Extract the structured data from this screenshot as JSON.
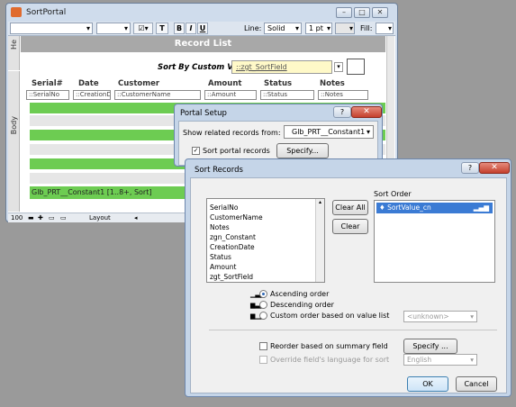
{
  "window": {
    "title": "SortPortal",
    "min": "–",
    "max": "□",
    "close": "✕"
  },
  "toolbar": {
    "bold": "B",
    "italic": "I",
    "underline": "U",
    "text_tool": "T",
    "line_label": "Line:",
    "line_style": "Solid",
    "line_width": "1 pt",
    "fill_label": "Fill:"
  },
  "layout": {
    "header_tab": "He",
    "body_tab": "Body",
    "title": "Record List",
    "sort_by_label": "Sort By Custom Value",
    "sort_field": "::zgt_SortField",
    "columns": [
      "Serial#",
      "Date",
      "Customer",
      "Amount",
      "Status",
      "Notes"
    ],
    "fields": [
      "::SerialNo",
      "::CreationD",
      "::CustomerName",
      "::Amount",
      "::Status",
      "::Notes"
    ],
    "portal_label": "Glb_PRT__Constant1 [1..8+, Sort]"
  },
  "statusbar": {
    "zoom": "100",
    "mode": "Layout"
  },
  "portal_setup": {
    "title": "Portal Setup",
    "show_records_label": "Show related records from:",
    "show_records_value": "Glb_PRT__Constant1",
    "sort_portal_label": "Sort portal records",
    "specify_label": "Specify..."
  },
  "sort_records": {
    "title": "Sort Records",
    "fields": [
      "SerialNo",
      "CustomerName",
      "Notes",
      "zgn_Constant",
      "CreationDate",
      "Status",
      "Amount",
      "zgt_SortField"
    ],
    "clear_all": "Clear All",
    "clear": "Clear",
    "sort_order_label": "Sort Order",
    "sort_order_items": [
      "SortValue_cn"
    ],
    "ascending": "Ascending order",
    "descending": "Descending order",
    "custom_order": "Custom order based on value list",
    "value_list_placeholder": "<unknown>",
    "reorder_summary": "Reorder based on summary field",
    "specify": "Specify ...",
    "override_language": "Override field's language for sort",
    "language": "English",
    "ok": "OK",
    "cancel": "Cancel"
  }
}
